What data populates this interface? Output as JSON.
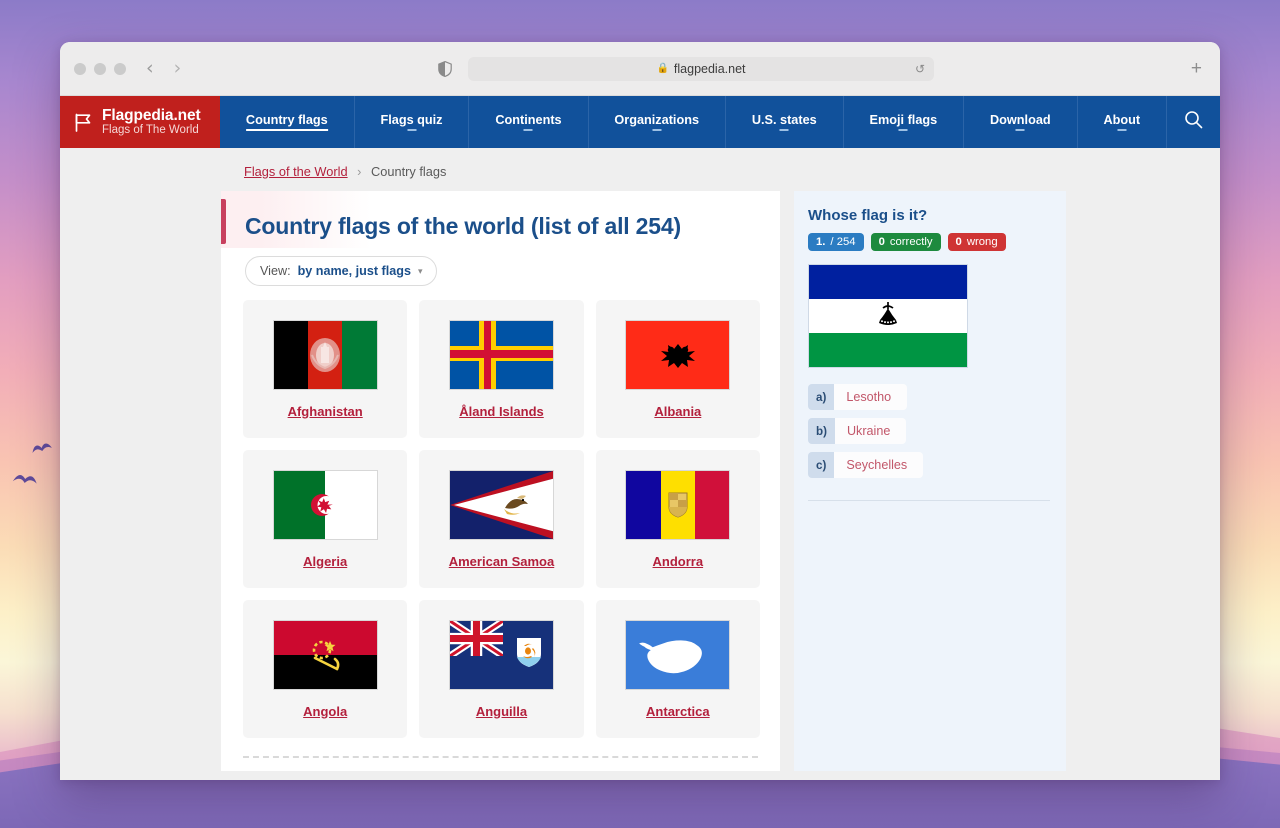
{
  "browser": {
    "url": "flagpedia.net",
    "lock_icon": "lock-icon",
    "shield_icon": "shield-icon",
    "reload_icon": "reload-icon",
    "new_tab_label": "+",
    "back_arrow": "‹",
    "forward_arrow": "›"
  },
  "site": {
    "logo": {
      "title": "Flagpedia.net",
      "subtitle": "Flags of The World",
      "icon": "flag-logo-icon"
    },
    "nav": [
      {
        "label": "Country flags",
        "active": true
      },
      {
        "label": "Flags quiz",
        "active": false
      },
      {
        "label": "Continents",
        "active": false
      },
      {
        "label": "Organizations",
        "active": false
      },
      {
        "label": "U.S. states",
        "active": false
      },
      {
        "label": "Emoji flags",
        "active": false
      },
      {
        "label": "Download",
        "active": false
      },
      {
        "label": "About",
        "active": false
      }
    ],
    "search_icon": "search-icon",
    "colors": {
      "nav_blue": "#11519b",
      "logo_red": "#c0201d",
      "link_red": "#b3203c",
      "heading_blue": "#1b4f8a",
      "accent_bar": "#c8405e"
    }
  },
  "breadcrumb": {
    "home": "Flags of the World",
    "separator": "›",
    "current": "Country flags"
  },
  "main": {
    "title": "Country flags of the world (list of all 254)",
    "view": {
      "label": "View:",
      "value": "by name, just flags",
      "chevron": "▾"
    },
    "flags": [
      {
        "name": "Afghanistan"
      },
      {
        "name": "Åland Islands"
      },
      {
        "name": "Albania"
      },
      {
        "name": "Algeria"
      },
      {
        "name": "American Samoa"
      },
      {
        "name": "Andorra"
      },
      {
        "name": "Angola"
      },
      {
        "name": "Anguilla"
      },
      {
        "name": "Antarctica"
      }
    ]
  },
  "quiz": {
    "title": "Whose flag is it?",
    "badges": {
      "progress_num": "1.",
      "progress_total": "/ 254",
      "correct_num": "0",
      "correct_label": "correctly",
      "wrong_num": "0",
      "wrong_label": "wrong"
    },
    "flag_alt": "lesotho-flag",
    "answers": [
      {
        "key": "a)",
        "text": "Lesotho"
      },
      {
        "key": "b)",
        "text": "Ukraine"
      },
      {
        "key": "c)",
        "text": "Seychelles"
      }
    ]
  }
}
